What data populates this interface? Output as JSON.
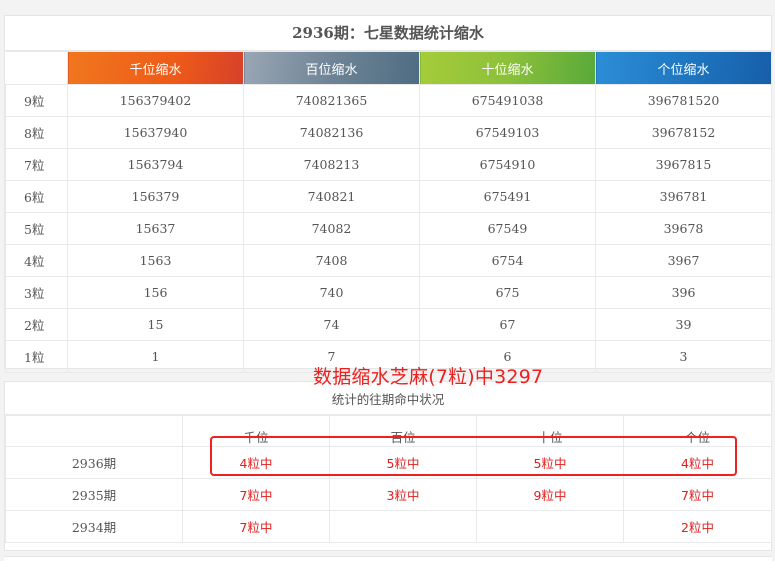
{
  "main_table": {
    "title": "2936期：七星数据统计缩水",
    "headers": [
      "千位缩水",
      "百位缩水",
      "十位缩水",
      "个位缩水"
    ],
    "header_colors": [
      "#ee5b18",
      "#6e8496",
      "#8cc03b",
      "#1d72bd"
    ],
    "rows": [
      {
        "label": "9粒",
        "values": [
          "156379402",
          "740821365",
          "675491038",
          "396781520"
        ]
      },
      {
        "label": "8粒",
        "values": [
          "15637940",
          "74082136",
          "67549103",
          "39678152"
        ]
      },
      {
        "label": "7粒",
        "values": [
          "1563794",
          "7408213",
          "6754910",
          "3967815"
        ]
      },
      {
        "label": "6粒",
        "values": [
          "156379",
          "740821",
          "675491",
          "396781"
        ]
      },
      {
        "label": "5粒",
        "values": [
          "15637",
          "74082",
          "67549",
          "39678"
        ]
      },
      {
        "label": "4粒",
        "values": [
          "1563",
          "7408",
          "6754",
          "3967"
        ]
      },
      {
        "label": "3粒",
        "values": [
          "156",
          "740",
          "675",
          "396"
        ]
      },
      {
        "label": "2粒",
        "values": [
          "15",
          "74",
          "67",
          "39"
        ]
      },
      {
        "label": "1粒",
        "values": [
          "1",
          "7",
          "6",
          "3"
        ]
      }
    ]
  },
  "annotation": {
    "text": "数据缩水芝麻(7粒)中3297",
    "color": "#ee1f1f"
  },
  "history_table": {
    "subtitle": "统计的往期命中状况",
    "headers": [
      "千位",
      "百位",
      "十位",
      "个位"
    ],
    "rows": [
      {
        "period": "2936期",
        "values": [
          "4粒中",
          "5粒中",
          "5粒中",
          "4粒中"
        ]
      },
      {
        "period": "2935期",
        "values": [
          "7粒中",
          "3粒中",
          "9粒中",
          "7粒中"
        ]
      },
      {
        "period": "2934期",
        "values": [
          "7粒中",
          "",
          "",
          "2粒中"
        ]
      }
    ],
    "hit_color": "#e02020"
  }
}
